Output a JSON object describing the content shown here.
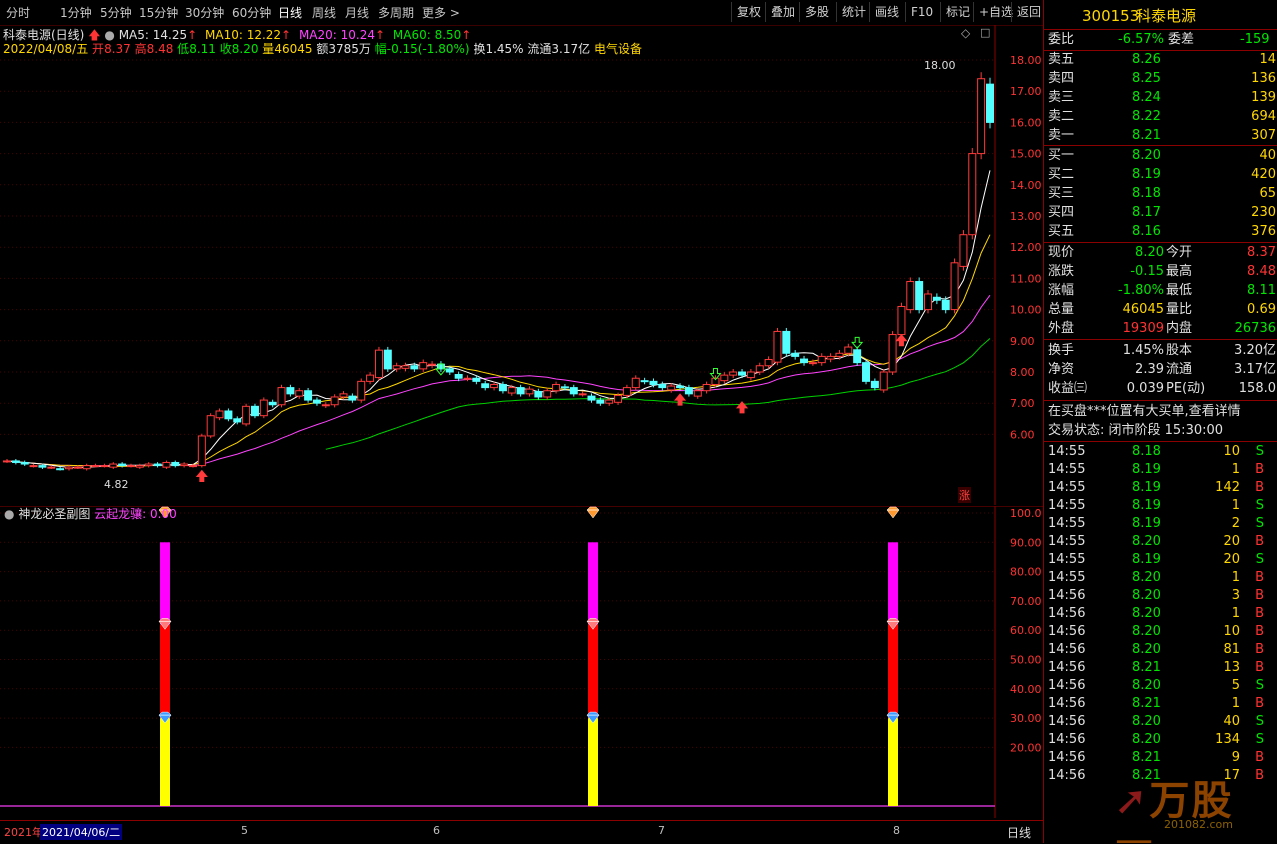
{
  "toolbar": {
    "periods": [
      "分时",
      "1分钟",
      "5分钟",
      "15分钟",
      "30分钟",
      "60分钟",
      "日线",
      "周线",
      "月线",
      "多周期",
      "更多"
    ],
    "active": "日线",
    "right_buttons": [
      "复权",
      "叠加",
      "多股",
      "统计",
      "画线",
      "F10",
      "标记",
      "+自选",
      "返回"
    ]
  },
  "header": {
    "title": "科泰电源(日线)",
    "ma5": "MA5: 14.25",
    "ma10": "MA10: 12.22",
    "ma20": "MA20: 10.24",
    "ma60": "MA60: 8.50",
    "date": "2022/04/08/五",
    "open_label": "开",
    "open": "8.37",
    "high_label": "高",
    "high": "8.48",
    "low_label": "低",
    "low": "8.11",
    "close_label": "收",
    "close": "8.20",
    "vol_label": "量",
    "vol": "46045",
    "amount_label": "额",
    "amount": "3785万",
    "change_label": "幅",
    "change": "-0.15(-1.80%)",
    "turnover": "换1.45%",
    "float": "流通3.17亿",
    "sector": "电气设备"
  },
  "chart_data": {
    "type": "candlestick",
    "y_ticks": [
      "18.00",
      "17.00",
      "16.00",
      "15.00",
      "14.00",
      "13.00",
      "12.00",
      "11.00",
      "10.00",
      "9.00",
      "8.00",
      "7.00",
      "6.00"
    ],
    "max_label": "18.00",
    "min_label": "4.82",
    "zhang_badge": "涨"
  },
  "sub_chart": {
    "title": "神龙必圣副图",
    "indicator": "云起龙骧: 0.00",
    "y_ticks": [
      "100.0",
      "90.00",
      "80.00",
      "70.00",
      "60.00",
      "50.00",
      "40.00",
      "30.00",
      "20.00"
    ],
    "bars": [
      {
        "yellow": 30,
        "red": 62,
        "magenta": 90
      },
      {
        "yellow": 30,
        "red": 62,
        "magenta": 90
      },
      {
        "yellow": 30,
        "red": 62,
        "magenta": 90
      }
    ]
  },
  "date_axis": {
    "start": "2021年",
    "selected": "2021/04/06/二",
    "ticks": [
      "5",
      "6",
      "7",
      "8"
    ],
    "period_label": "日线"
  },
  "quote": {
    "code": "300153",
    "name": "科泰电源",
    "webi_label": "委比",
    "webi": "-6.57%",
    "weicha_label": "委差",
    "weicha": "-159",
    "asks": [
      {
        "label": "卖五",
        "price": "8.26",
        "vol": "14"
      },
      {
        "label": "卖四",
        "price": "8.25",
        "vol": "136"
      },
      {
        "label": "卖三",
        "price": "8.24",
        "vol": "139"
      },
      {
        "label": "卖二",
        "price": "8.22",
        "vol": "694"
      },
      {
        "label": "卖一",
        "price": "8.21",
        "vol": "307"
      }
    ],
    "bids": [
      {
        "label": "买一",
        "price": "8.20",
        "vol": "40"
      },
      {
        "label": "买二",
        "price": "8.19",
        "vol": "420"
      },
      {
        "label": "买三",
        "price": "8.18",
        "vol": "65"
      },
      {
        "label": "买四",
        "price": "8.17",
        "vol": "230"
      },
      {
        "label": "买五",
        "price": "8.16",
        "vol": "376"
      }
    ],
    "stats": [
      {
        "l1": "现价",
        "v1": "8.20",
        "c1": "g",
        "l2": "今开",
        "v2": "8.37",
        "c2": "r"
      },
      {
        "l1": "涨跌",
        "v1": "-0.15",
        "c1": "g",
        "l2": "最高",
        "v2": "8.48",
        "c2": "r"
      },
      {
        "l1": "涨幅",
        "v1": "-1.80%",
        "c1": "g",
        "l2": "最低",
        "v2": "8.11",
        "c2": "g"
      },
      {
        "l1": "总量",
        "v1": "46045",
        "c1": "y",
        "l2": "量比",
        "v2": "0.69",
        "c2": "y"
      },
      {
        "l1": "外盘",
        "v1": "19309",
        "c1": "r",
        "l2": "内盘",
        "v2": "26736",
        "c2": "g"
      }
    ],
    "stats2": [
      {
        "l1": "换手",
        "v1": "1.45%",
        "l2": "股本",
        "v2": "3.20亿"
      },
      {
        "l1": "净资",
        "v1": "2.39",
        "l2": "流通",
        "v2": "3.17亿"
      },
      {
        "l1": "收益㈢",
        "v1": "0.039",
        "l2": "PE(动)",
        "v2": "158.0"
      }
    ],
    "notice": "在买盘***位置有大买单,查看详情",
    "status": "交易状态: 闭市阶段 15:30:00",
    "trades": [
      {
        "t": "14:55",
        "p": "8.18",
        "v": "10",
        "s": "S"
      },
      {
        "t": "14:55",
        "p": "8.19",
        "v": "1",
        "s": "B"
      },
      {
        "t": "14:55",
        "p": "8.19",
        "v": "142",
        "s": "B"
      },
      {
        "t": "14:55",
        "p": "8.19",
        "v": "1",
        "s": "S"
      },
      {
        "t": "14:55",
        "p": "8.19",
        "v": "2",
        "s": "S"
      },
      {
        "t": "14:55",
        "p": "8.20",
        "v": "20",
        "s": "B"
      },
      {
        "t": "14:55",
        "p": "8.19",
        "v": "20",
        "s": "S"
      },
      {
        "t": "14:55",
        "p": "8.20",
        "v": "1",
        "s": "B"
      },
      {
        "t": "14:56",
        "p": "8.20",
        "v": "3",
        "s": "B"
      },
      {
        "t": "14:56",
        "p": "8.20",
        "v": "1",
        "s": "B"
      },
      {
        "t": "14:56",
        "p": "8.20",
        "v": "10",
        "s": "B"
      },
      {
        "t": "14:56",
        "p": "8.20",
        "v": "81",
        "s": "B"
      },
      {
        "t": "14:56",
        "p": "8.21",
        "v": "13",
        "s": "B"
      },
      {
        "t": "14:56",
        "p": "8.20",
        "v": "5",
        "s": "S"
      },
      {
        "t": "14:56",
        "p": "8.21",
        "v": "1",
        "s": "B"
      },
      {
        "t": "14:56",
        "p": "8.20",
        "v": "40",
        "s": "S"
      },
      {
        "t": "14:56",
        "p": "8.20",
        "v": "134",
        "s": "S"
      },
      {
        "t": "14:56",
        "p": "8.21",
        "v": "9",
        "s": "B"
      },
      {
        "t": "14:56",
        "p": "8.21",
        "v": "17",
        "s": "B"
      }
    ]
  },
  "watermark": {
    "text": "万股网",
    "sub": "201082.com"
  }
}
